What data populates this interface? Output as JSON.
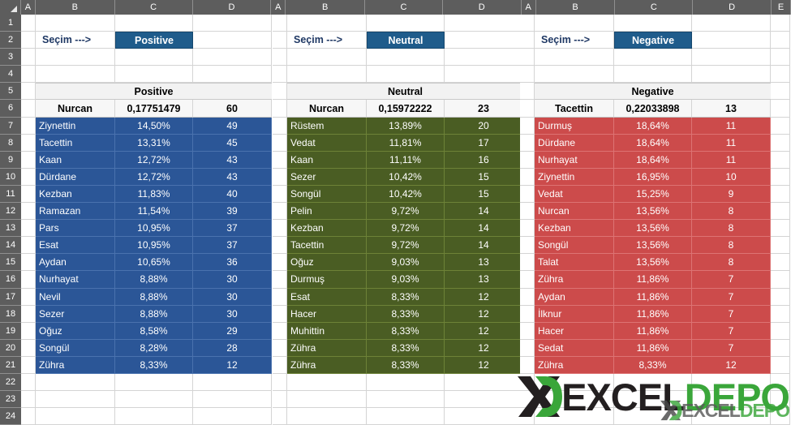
{
  "app": {
    "type": "spreadsheet",
    "panel_count": 3
  },
  "grid": {
    "column_headers_panel": [
      "A",
      "B",
      "C",
      "D"
    ],
    "extra_column_header": "E",
    "row_numbers": [
      "1",
      "2",
      "3",
      "4",
      "5",
      "6",
      "7",
      "8",
      "9",
      "10",
      "11",
      "12",
      "13",
      "14",
      "15",
      "16",
      "17",
      "18",
      "19",
      "20",
      "21",
      "22",
      "23",
      "24"
    ]
  },
  "colors": {
    "dropdown_fill": "#1F5C8B",
    "positive_fill": "#2B5697",
    "neutral_fill": "#4A5D23",
    "negative_fill": "#CC4B4B",
    "header_text": "#1F3864",
    "col_header_bg": "#5D5D5D",
    "band_bg": "#F2F2F2"
  },
  "panels": [
    {
      "id": "positive",
      "selector_label": "Seçim --->",
      "selected_value": "Positive",
      "title": "Positive",
      "summary": {
        "name": "Nurcan",
        "ratio": "0,17751479",
        "count": "60"
      },
      "fill": "#2B5697",
      "rows": [
        {
          "name": "Ziynettin",
          "pct": "14,50%",
          "count": "49"
        },
        {
          "name": "Tacettin",
          "pct": "13,31%",
          "count": "45"
        },
        {
          "name": "Kaan",
          "pct": "12,72%",
          "count": "43"
        },
        {
          "name": "Dürdane",
          "pct": "12,72%",
          "count": "43"
        },
        {
          "name": "Kezban",
          "pct": "11,83%",
          "count": "40"
        },
        {
          "name": "Ramazan",
          "pct": "11,54%",
          "count": "39"
        },
        {
          "name": "Pars",
          "pct": "10,95%",
          "count": "37"
        },
        {
          "name": "Esat",
          "pct": "10,95%",
          "count": "37"
        },
        {
          "name": "Aydan",
          "pct": "10,65%",
          "count": "36"
        },
        {
          "name": "Nurhayat",
          "pct": "8,88%",
          "count": "30"
        },
        {
          "name": "Nevil",
          "pct": "8,88%",
          "count": "30"
        },
        {
          "name": "Sezer",
          "pct": "8,88%",
          "count": "30"
        },
        {
          "name": "Oğuz",
          "pct": "8,58%",
          "count": "29"
        },
        {
          "name": "Songül",
          "pct": "8,28%",
          "count": "28"
        },
        {
          "name": "Zühra",
          "pct": "8,33%",
          "count": "12"
        }
      ]
    },
    {
      "id": "neutral",
      "selector_label": "Seçim --->",
      "selected_value": "Neutral",
      "title": "Neutral",
      "summary": {
        "name": "Nurcan",
        "ratio": "0,15972222",
        "count": "23"
      },
      "fill": "#4A5D23",
      "rows": [
        {
          "name": "Rüstem",
          "pct": "13,89%",
          "count": "20"
        },
        {
          "name": "Vedat",
          "pct": "11,81%",
          "count": "17"
        },
        {
          "name": "Kaan",
          "pct": "11,11%",
          "count": "16"
        },
        {
          "name": "Sezer",
          "pct": "10,42%",
          "count": "15"
        },
        {
          "name": "Songül",
          "pct": "10,42%",
          "count": "15"
        },
        {
          "name": "Pelin",
          "pct": "9,72%",
          "count": "14"
        },
        {
          "name": "Kezban",
          "pct": "9,72%",
          "count": "14"
        },
        {
          "name": "Tacettin",
          "pct": "9,72%",
          "count": "14"
        },
        {
          "name": "Oğuz",
          "pct": "9,03%",
          "count": "13"
        },
        {
          "name": "Durmuş",
          "pct": "9,03%",
          "count": "13"
        },
        {
          "name": "Esat",
          "pct": "8,33%",
          "count": "12"
        },
        {
          "name": "Hacer",
          "pct": "8,33%",
          "count": "12"
        },
        {
          "name": "Muhittin",
          "pct": "8,33%",
          "count": "12"
        },
        {
          "name": "Zühra",
          "pct": "8,33%",
          "count": "12"
        },
        {
          "name": "Zühra",
          "pct": "8,33%",
          "count": "12"
        }
      ]
    },
    {
      "id": "negative",
      "selector_label": "Seçim --->",
      "selected_value": "Negative",
      "title": "Negative",
      "summary": {
        "name": "Tacettin",
        "ratio": "0,22033898",
        "count": "13"
      },
      "fill": "#CC4B4B",
      "rows": [
        {
          "name": "Durmuş",
          "pct": "18,64%",
          "count": "11"
        },
        {
          "name": "Dürdane",
          "pct": "18,64%",
          "count": "11"
        },
        {
          "name": "Nurhayat",
          "pct": "18,64%",
          "count": "11"
        },
        {
          "name": "Ziynettin",
          "pct": "16,95%",
          "count": "10"
        },
        {
          "name": "Vedat",
          "pct": "15,25%",
          "count": "9"
        },
        {
          "name": "Nurcan",
          "pct": "13,56%",
          "count": "8"
        },
        {
          "name": "Kezban",
          "pct": "13,56%",
          "count": "8"
        },
        {
          "name": "Songül",
          "pct": "13,56%",
          "count": "8"
        },
        {
          "name": "Talat",
          "pct": "13,56%",
          "count": "8"
        },
        {
          "name": "Zühra",
          "pct": "11,86%",
          "count": "7"
        },
        {
          "name": "Aydan",
          "pct": "11,86%",
          "count": "7"
        },
        {
          "name": "İlknur",
          "pct": "11,86%",
          "count": "7"
        },
        {
          "name": "Hacer",
          "pct": "11,86%",
          "count": "7"
        },
        {
          "name": "Sedat",
          "pct": "11,86%",
          "count": "7"
        },
        {
          "name": "Zühra",
          "pct": "8,33%",
          "count": "12"
        }
      ]
    }
  ],
  "watermark": {
    "text_primary": "EXCEL",
    "text_secondary": "DEPO",
    "mark": "xd-logo-icon"
  }
}
